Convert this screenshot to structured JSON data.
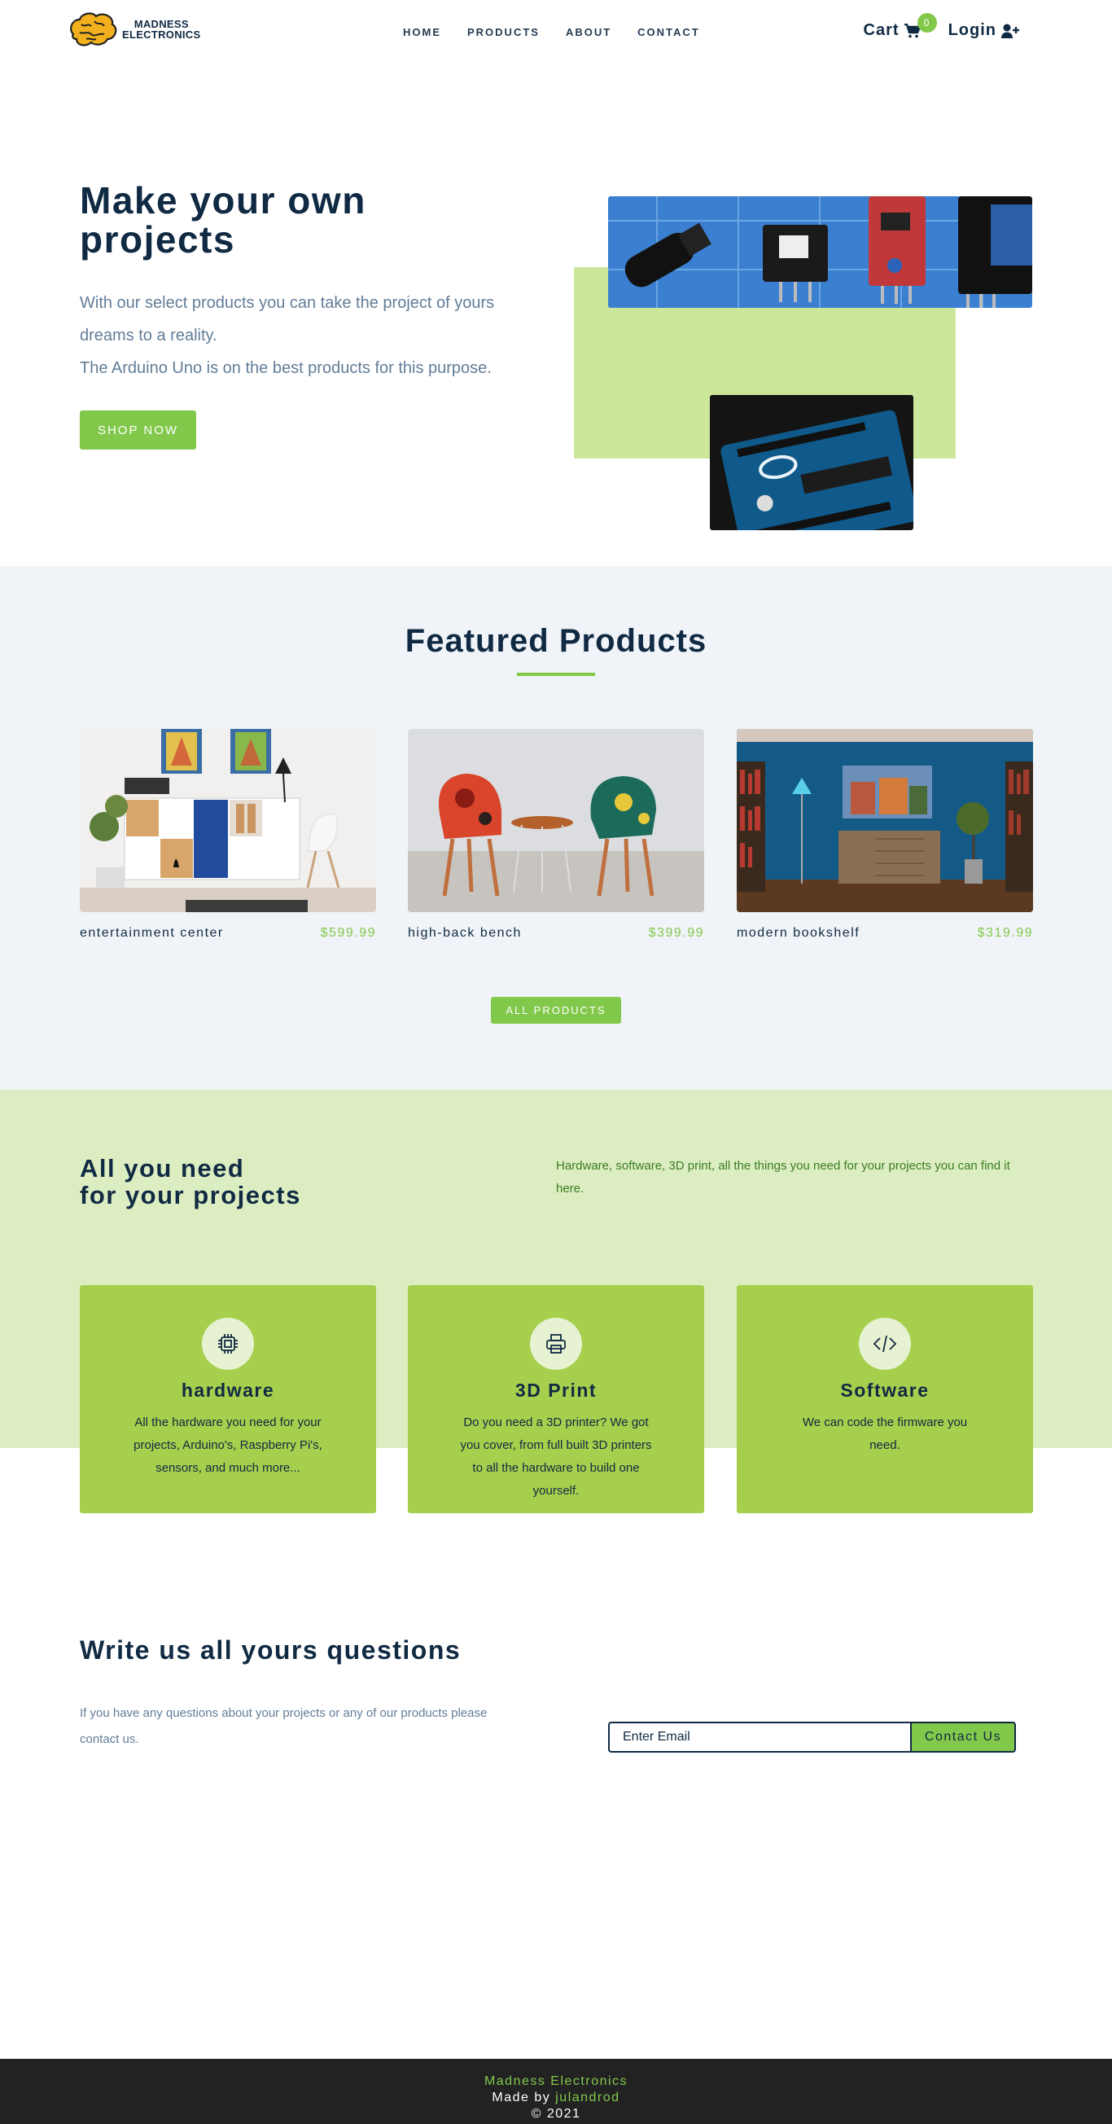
{
  "brand": {
    "line1": "MADNESS",
    "line2": "ELECTRONICS"
  },
  "nav": {
    "links": [
      "HOME",
      "PRODUCTS",
      "ABOUT",
      "CONTACT"
    ],
    "cart_label": "Cart",
    "cart_count": "0",
    "login_label": "Login"
  },
  "hero": {
    "title": "Make your own projects",
    "text1": "With our select products you can take the project of yours dreams to a reality.",
    "text2": "The Arduino Uno is on the best products for this purpose.",
    "cta": "SHOP NOW"
  },
  "featured": {
    "title": "Featured Products",
    "products": [
      {
        "name": "entertainment center",
        "price": "$599.99"
      },
      {
        "name": "high-back bench",
        "price": "$399.99"
      },
      {
        "name": "modern bookshelf",
        "price": "$319.99"
      }
    ],
    "all_label": "ALL PRODUCTS"
  },
  "needs": {
    "title_line1": "All you need",
    "title_line2": "for your projects",
    "text": "Hardware, software, 3D print, all the things you need for your projects you can find it here.",
    "services": [
      {
        "title": "hardware",
        "text": "All the hardware you need for your projects, Arduino's, Raspberry Pi's, sensors, and much more..."
      },
      {
        "title": "3D Print",
        "text": "Do you need a 3D printer? We got you cover, from full built 3D printers to all the hardware to build one yourself."
      },
      {
        "title": "Software",
        "text": "We can code the firmware you need."
      }
    ]
  },
  "contact": {
    "title": "Write us all yours questions",
    "text": "If you have any questions about your projects or any of our products please contact us.",
    "placeholder": "Enter Email",
    "button": "Contact Us"
  },
  "footer": {
    "brand": "Madness Electronics",
    "made_by": "Made by",
    "author": "julandrod",
    "copyright": "© 2021"
  },
  "colors": {
    "accent": "#82c94b",
    "navy": "#102a43",
    "light_green": "#dcedc1",
    "card_green": "#a5cf4c"
  }
}
